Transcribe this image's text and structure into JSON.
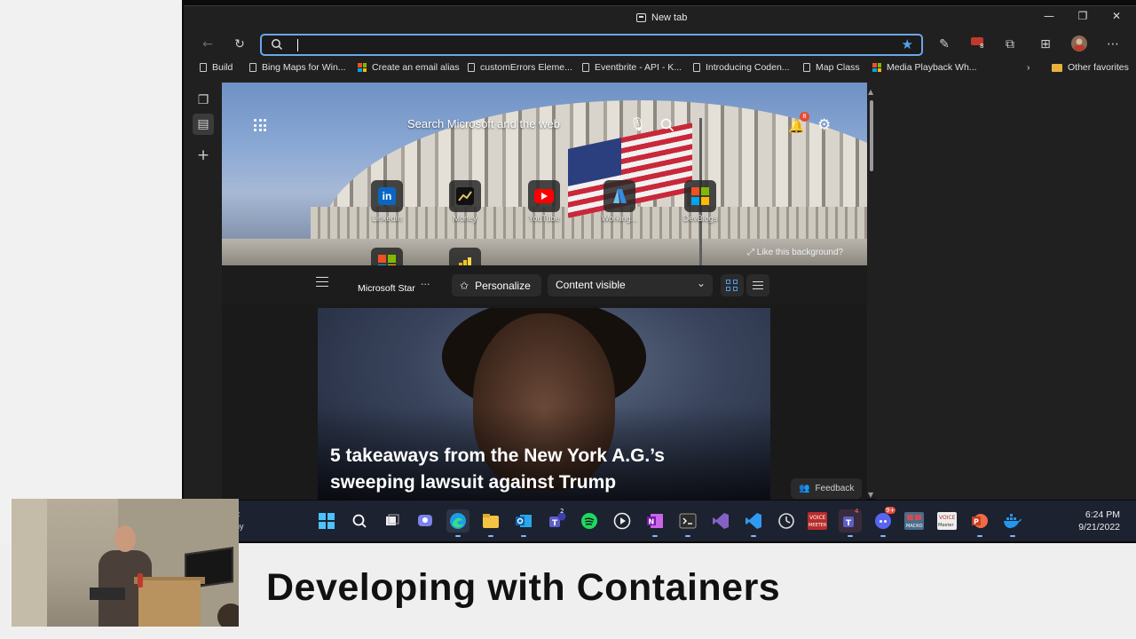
{
  "slide": {
    "title": "Developing with Containers"
  },
  "browser": {
    "tab_title": "New tab",
    "address_placeholder": "",
    "address_value": "",
    "notifications_count": "8",
    "bookmarks": [
      {
        "label": "Build",
        "icon": "page-icon"
      },
      {
        "label": "Bing Maps for Win...",
        "icon": "page-icon"
      },
      {
        "label": "Create an email alias",
        "icon": "microsoft-logo-icon"
      },
      {
        "label": "customErrors Eleme...",
        "icon": "page-icon"
      },
      {
        "label": "Eventbrite - API - K...",
        "icon": "page-icon"
      },
      {
        "label": "Introducing Coden...",
        "icon": "page-icon"
      },
      {
        "label": "Map Class",
        "icon": "page-icon"
      },
      {
        "label": "Media Playback Wh...",
        "icon": "microsoft-logo-icon"
      }
    ],
    "other_favorites": "Other favorites"
  },
  "ntp": {
    "search_placeholder": "Search Microsoft and the web",
    "notification_badge": "8",
    "tiles_row1": [
      {
        "label": "LinkedIn",
        "icon": "linkedin-icon"
      },
      {
        "label": "Money",
        "icon": "money-chart-icon"
      },
      {
        "label": "YouTube",
        "icon": "youtube-icon"
      },
      {
        "label": "Working...",
        "icon": "azure-icon"
      },
      {
        "label": "DevBlogs",
        "icon": "microsoft-logo-icon"
      }
    ],
    "tiles_row2": [
      {
        "label": "Microsoft Star",
        "icon": "microsoft-logo-icon"
      },
      {
        "label": "",
        "icon": "power-bi-icon"
      }
    ],
    "like_background": "Like this background?",
    "personalize": "Personalize",
    "content_visibility": "Content visible",
    "headline": "5 takeaways from the New York A.G.’s sweeping lawsuit against Trump",
    "feedback": "Feedback"
  },
  "taskbar": {
    "time": "6:24 PM",
    "date": "9/21/2022",
    "partial_widget_line1": "F",
    "partial_widget_line2": "ny",
    "teams_badge": "2",
    "teams2_badge": "4",
    "discord_badge": "9+",
    "apps": [
      "start-icon",
      "search-icon",
      "task-view-icon",
      "chat-icon",
      "edge-icon",
      "file-explorer-icon",
      "outlook-icon",
      "teams-icon",
      "spotify-icon",
      "media-player-icon",
      "onenote-icon",
      "terminal-icon",
      "visual-studio-icon",
      "vscode-icon",
      "clock-icon",
      "voicemeeter-icon",
      "teams-work-icon",
      "discord-icon",
      "macro-icon",
      "voicemeeter-banana-icon",
      "powerpoint-icon",
      "docker-icon"
    ]
  },
  "colors": {
    "accent": "#4c9be8",
    "address_focus": "#6aa7e8",
    "browser_bg": "#202020",
    "taskbar_bg": "#1c2230"
  }
}
